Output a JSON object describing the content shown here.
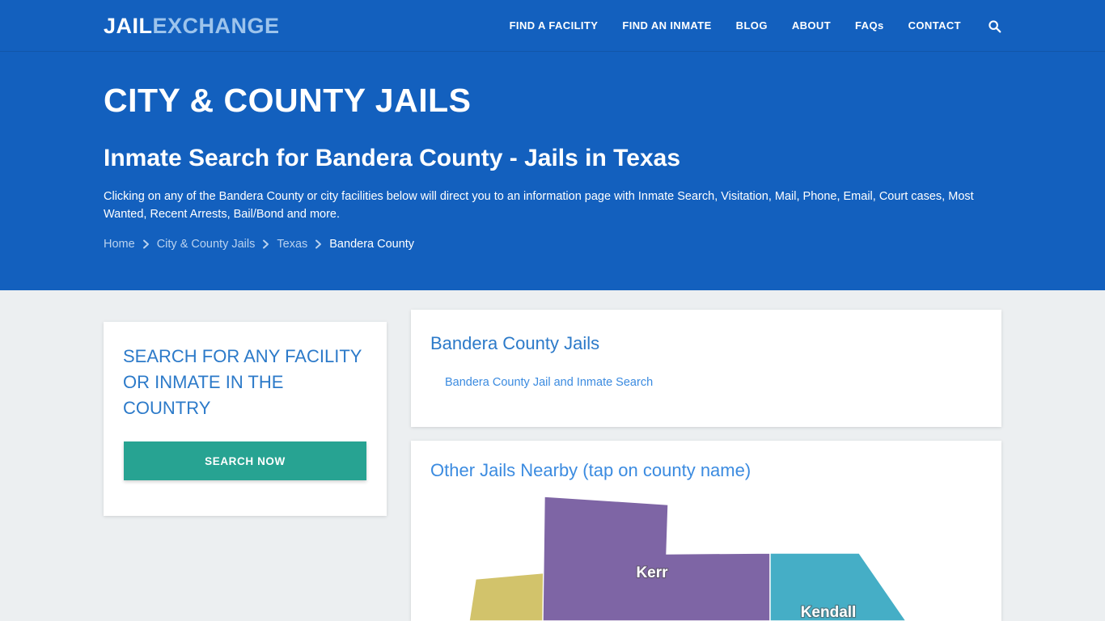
{
  "brand": {
    "part1": "JAIL",
    "part2": "EXCHANGE"
  },
  "nav": {
    "items": [
      {
        "label": "FIND A FACILITY",
        "name": "nav-find-a-facility"
      },
      {
        "label": "FIND AN INMATE",
        "name": "nav-find-an-inmate"
      },
      {
        "label": "BLOG",
        "name": "nav-blog"
      },
      {
        "label": "ABOUT",
        "name": "nav-about"
      },
      {
        "label": "FAQs",
        "name": "nav-faqs"
      },
      {
        "label": "CONTACT",
        "name": "nav-contact"
      }
    ],
    "search_icon": "search-icon"
  },
  "hero": {
    "title": "CITY & COUNTY JAILS",
    "subtitle": "Inmate Search for Bandera County - Jails in Texas",
    "description": "Clicking on any of the Bandera County or city facilities below will direct you to an information page with Inmate Search, Visitation, Mail, Phone, Email, Court cases, Most Wanted, Recent Arrests, Bail/Bond and more.",
    "breadcrumb": [
      {
        "label": "Home"
      },
      {
        "label": "City & County Jails"
      },
      {
        "label": "Texas"
      },
      {
        "label": "Bandera County"
      }
    ],
    "breadcrumb_separator": "›"
  },
  "search_card": {
    "title": "SEARCH FOR ANY FACILITY OR INMATE IN THE COUNTRY",
    "button_label": "SEARCH NOW"
  },
  "jails_card": {
    "title": "Bandera County Jails",
    "links": [
      {
        "label": "Bandera County Jail and Inmate Search"
      }
    ]
  },
  "nearby_card": {
    "title": "Other Jails Nearby (tap on county name)",
    "counties": [
      {
        "name": "Kerr",
        "color": "#7e65a5",
        "label_visible": true
      },
      {
        "name": "Kendall",
        "color": "#45aec6",
        "label_visible": true
      },
      {
        "name": "",
        "color": "#d2c36b",
        "label_visible": false
      }
    ]
  },
  "colors": {
    "brand_blue": "#1360be",
    "page_bg": "#eceff1",
    "accent_teal": "#27a392",
    "link_blue": "#3b8be0",
    "heading_blue": "#2c7ac9"
  }
}
